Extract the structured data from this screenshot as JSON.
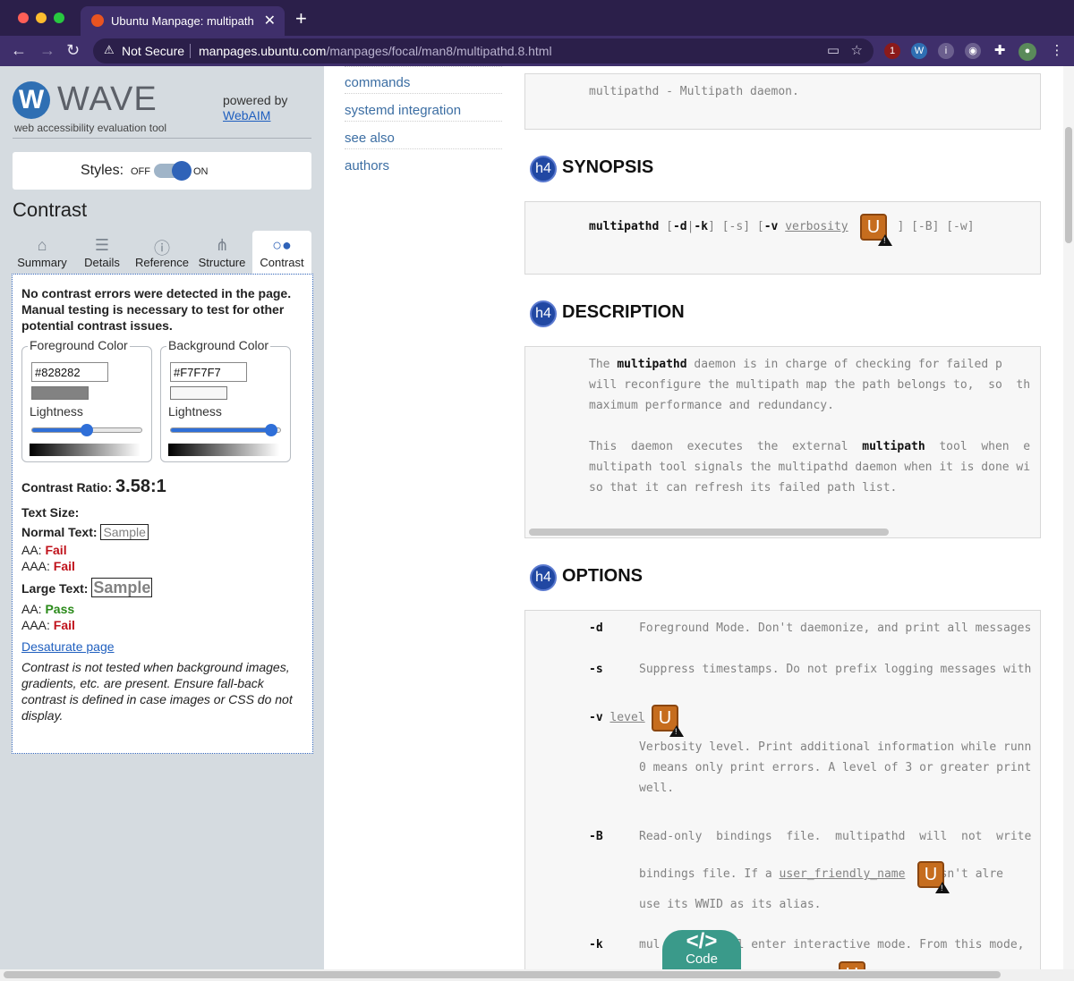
{
  "browser": {
    "tab_title": "Ubuntu Manpage: multipathd -",
    "tab_close": "✕",
    "new_tab": "+",
    "not_secure": "Not Secure",
    "url_host": "manpages.ubuntu.com",
    "url_path": "/manpages/focal/man8/multipathd.8.html",
    "ext_badge": "1"
  },
  "wave": {
    "logo_letter": "W",
    "logo_text": "WAVE",
    "logo_sub": "web accessibility evaluation tool",
    "powered_by": "powered by",
    "webaim": "WebAIM",
    "styles_label": "Styles:",
    "styles_off": "OFF",
    "styles_on": "ON",
    "panel_title": "Contrast",
    "tabs": [
      {
        "label": "Summary",
        "icon": "home-icon",
        "glyph": "⌂"
      },
      {
        "label": "Details",
        "icon": "list-icon",
        "glyph": "☰"
      },
      {
        "label": "Reference",
        "icon": "info-icon",
        "glyph": "ⓘ"
      },
      {
        "label": "Structure",
        "icon": "structure-icon",
        "glyph": "⋔"
      },
      {
        "label": "Contrast",
        "icon": "contrast-icon",
        "glyph": "○●"
      }
    ],
    "message": "No contrast errors were detected in the page. Manual testing is necessary to test for other potential contrast issues.",
    "foreground": {
      "legend": "Foreground Color",
      "hex": "#828282",
      "lightness_label": "Lightness",
      "lightness": 0.5
    },
    "background": {
      "legend": "Background Color",
      "hex": "#F7F7F7",
      "lightness_label": "Lightness",
      "lightness": 0.92
    },
    "ratio_label": "Contrast Ratio:",
    "ratio_value": "3.58:1",
    "text_size": "Text Size:",
    "normal_text": "Normal Text:",
    "large_text": "Large Text:",
    "sample": "Sample",
    "aa": "AA:",
    "aaa": "AAA:",
    "normal_aa": "Fail",
    "normal_aaa": "Fail",
    "large_aa": "Pass",
    "large_aaa": "Fail",
    "desaturate": "Desaturate page",
    "note": "Contrast is not tested when background images, gradients, etc. are present. Ensure fall-back contrast is defined in case images or CSS do not display."
  },
  "toc": [
    "commands",
    "systemd integration",
    "see also",
    "authors"
  ],
  "name_line": "multipathd - Multipath daemon.",
  "synopsis": {
    "badge": "h4",
    "heading": "SYNOPSIS",
    "cmd": "multipathd",
    "p1": "[",
    "d": "-d",
    "pipe": "|",
    "k": "-k",
    "p2": "]",
    "s": "[-s]",
    "v_open": "[",
    "v": "-v",
    "verbosity": "verbosity",
    "v_close": "]",
    "b": "[-B]",
    "w": "[-w]"
  },
  "description": {
    "badge": "h4",
    "heading": "DESCRIPTION",
    "l1a": "The ",
    "l1b": "multipathd",
    "l1c": " daemon is in charge of checking for failed p",
    "l2": "will reconfigure the multipath map the path belongs to,  so  th",
    "l3": "maximum performance and redundancy.",
    "l4a": "This  daemon  executes  the  external  ",
    "l4b": "multipath",
    "l4c": "  tool  when  e",
    "l5": "multipath tool signals the multipathd daemon when it is done wi",
    "l6": "so that it can refresh its failed path list."
  },
  "options": {
    "badge": "h4",
    "heading": "OPTIONS",
    "d_flag": "-d",
    "d_text": "Foreground Mode. Don't daemonize, and print all messages",
    "s_flag": "-s",
    "s_text": "Suppress timestamps. Do not prefix logging messages with",
    "v_flag": "-v",
    "v_arg": "level",
    "v_t1": "Verbosity level. Print additional information while runn",
    "v_t2": "0 means only print errors. A level of 3 or greater print",
    "v_t3": "well.",
    "b_flag": "-B",
    "b_t1": "Read-only  bindings  file.  multipathd  will  not  write",
    "b_t2a": "bindings file. If a ",
    "b_t2b": "user_friendly_name",
    "b_t2c": "  doesn't alre",
    "b_t3": "use its WWID as its alias.",
    "k_flag": "-k",
    "k_text": "mul          ll enter interactive mode. From this mode,"
  },
  "ubadge_letter": "U",
  "code_button": {
    "icon": "</>",
    "label": "Code"
  }
}
